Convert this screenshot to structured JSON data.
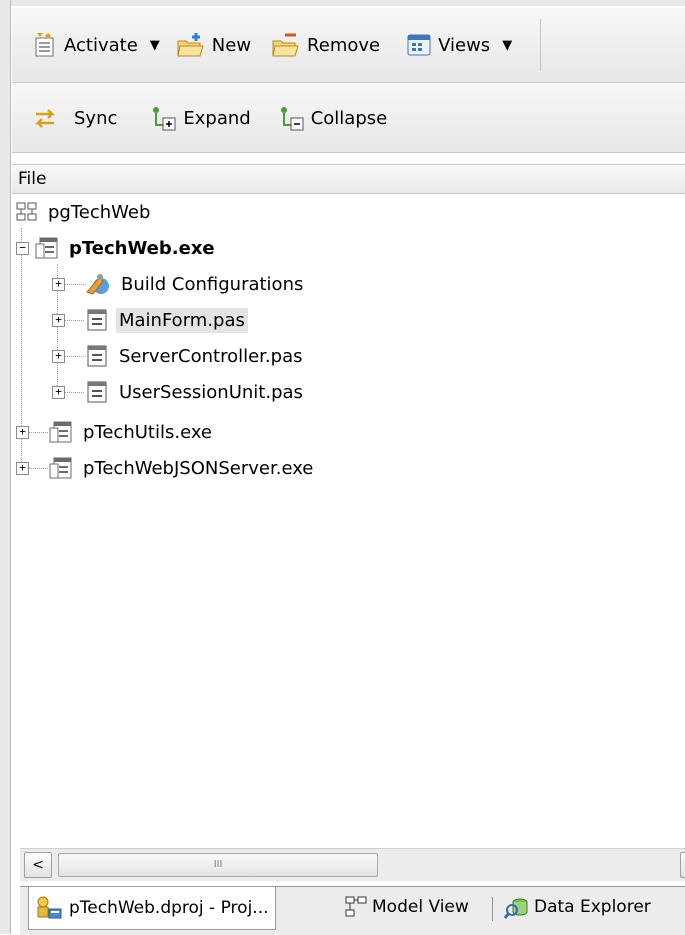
{
  "toolbar1": {
    "activate": "Activate",
    "new": "New",
    "remove": "Remove",
    "views": "Views"
  },
  "toolbar2": {
    "sync": "Sync",
    "expand": "Expand",
    "collapse": "Collapse"
  },
  "column_header": "File",
  "tree": {
    "project_group": "pgTechWeb",
    "project1": "pTechWeb.exe",
    "build_configs": "Build Configurations",
    "mainform": "MainForm.pas",
    "servercontroller": "ServerController.pas",
    "usersessionunit": "UserSessionUnit.pas",
    "project2": "pTechUtils.exe",
    "project3": "pTechWebJSONServer.exe",
    "expander_plus": "+",
    "expander_minus": "−"
  },
  "scrollbar": {
    "left": "<",
    "right": ">",
    "grip": "III"
  },
  "tabs": {
    "project": "pTechWeb.dproj - Proj...",
    "model": "Model View",
    "data": "Data Explorer"
  },
  "colors": {
    "selection": "#e4e4e4",
    "toolbar_bg": "#ececec",
    "project_icon": "#6b6b6b"
  }
}
